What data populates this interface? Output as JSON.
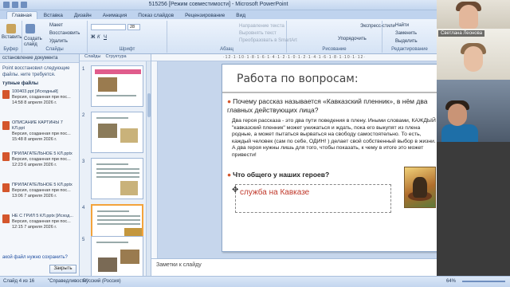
{
  "window": {
    "title": "515256 [Режим совместимости] - Microsoft PowerPoint"
  },
  "ribbon": {
    "tabs": [
      "Главная",
      "Вставка",
      "Дизайн",
      "Анимация",
      "Показ слайдов",
      "Рецензирование",
      "Вид"
    ],
    "active_tab": "Главная",
    "clipboard": {
      "label": "Вставить",
      "group": "Буфер"
    },
    "slides_group": {
      "create": "Создать слайд",
      "layout": "Макет",
      "restore": "Восстановить",
      "delete": "Удалить",
      "group": "Слайды"
    },
    "font_group": {
      "font_size": "28",
      "group": "Шрифт"
    },
    "paragraph_group": {
      "text_direction": "Направление текста",
      "align_text": "Выровнять текст",
      "smartart": "Преобразовать в SmartArt",
      "group": "Абзац"
    },
    "drawing_group": {
      "arrange": "Упорядочить",
      "quick_styles": "Экспресс-стили",
      "group": "Рисование"
    },
    "editing_group": {
      "find": "Найти",
      "replace": "Заменить",
      "select": "Выделить",
      "group": "Редактирование"
    }
  },
  "recovery_pane": {
    "header": "сстановление документа",
    "info": "Point восстановил следующие файлы. ните требуется.",
    "section": "тупные файлы",
    "files": [
      {
        "name": "100403.ppt [Исходный]",
        "line2": "Версия, созданная при пос...",
        "line3": "14:58 8 апреля 2026 г."
      },
      {
        "name": "ОПИСАНИЕ КАРТИНЫ 7 КЛ.ppt",
        "line2": "Версия, созданная при пос...",
        "line3": "15:48 8 апреля 2026 г."
      },
      {
        "name": "ПРИЛАГАТЕЛЬНОЕ 5 КЛ.pptx",
        "line2": "Версия, созданная при пос...",
        "line3": "12:23 6 апреля 2026 г."
      },
      {
        "name": "ПРИЛАГАТЕЛЬНОЕ 5 КЛ.pptx",
        "line2": "Версия, созданная при пос...",
        "line3": "13:06 7 апреля 2026 г."
      },
      {
        "name": "НЕ С ГРИЛ 5 КЛ.pptx [Исход...",
        "line2": "Версия, созданная при пос...",
        "line3": "12:15 7 апреля 2026 г."
      }
    ],
    "question": "акой файл нужно сохранить?",
    "close_button": "Закрыть"
  },
  "slides_panel": {
    "tabs": [
      "Слайды",
      "Структура"
    ],
    "numbers": [
      "1",
      "2",
      "3",
      "4",
      "5"
    ],
    "selected": "4"
  },
  "slide": {
    "title": "Работа по вопросам:",
    "question1": "Почему рассказ называется «Кавказский пленник», в нём два главных действующих лица?",
    "body": "Два героя рассказа - это два пути поведения в плену. Иными словами, КАЖДЫЙ \"кавказский пленник\" может унижаться и ждать, пока его выкупят из плена родные, а может пытаться вырваться на свободу самостоятельно. То есть, каждый человек (сам по себе, ОДИН! ) делает свой собственный выбор в жизни. А два героя нужны лишь для того, чтобы показать, к чему в итоге это может привести!",
    "question2": "Что общего у наших героев?",
    "answer": "служба на Кавказе"
  },
  "notes": {
    "placeholder": "Заметки к слайду"
  },
  "statusbar": {
    "slide_of": "Слайд 4 из 16",
    "theme": "\"Справедливость\"",
    "language": "Русский (Россия)",
    "zoom": "64%"
  },
  "video": {
    "participant_name": "Светлана Леонова"
  },
  "colors": {
    "ribbon_bg": "#d5e3f5",
    "accent": "#d4562c",
    "answer_text": "#c0392b",
    "selected_thumb": "#f3a33b"
  },
  "icons": [
    "paste-icon",
    "new-slide-icon",
    "office-button-icon",
    "file-icon",
    "find-icon",
    "picture-icon",
    "move-cursor-icon",
    "zoom-slider-icon"
  ]
}
